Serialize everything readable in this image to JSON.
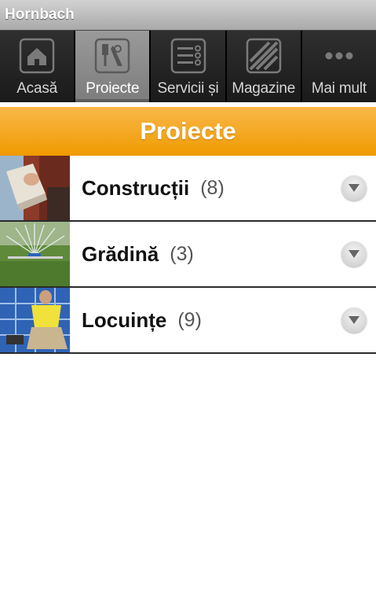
{
  "app": {
    "title": "Hornbach"
  },
  "tabs": [
    {
      "label": "Acasă",
      "icon": "home-icon",
      "active": false
    },
    {
      "label": "Proiecte",
      "icon": "tools-icon",
      "active": true
    },
    {
      "label": "Servicii și",
      "icon": "list-icon",
      "active": false
    },
    {
      "label": "Magazine",
      "icon": "stripes-icon",
      "active": false
    },
    {
      "label": "Mai mult",
      "icon": "more-icon",
      "active": false
    }
  ],
  "page": {
    "title": "Proiecte"
  },
  "categories": [
    {
      "name": "Construcții",
      "count": "(8)",
      "icon": "chevron-down-icon"
    },
    {
      "name": "Grădină",
      "count": "(3)",
      "icon": "chevron-down-icon"
    },
    {
      "name": "Locuințe",
      "count": "(9)",
      "icon": "chevron-down-icon"
    }
  ],
  "colors": {
    "accent": "#f0a000",
    "tab_bar": "#1b1b1b",
    "tab_active": "#8a8a8a"
  }
}
